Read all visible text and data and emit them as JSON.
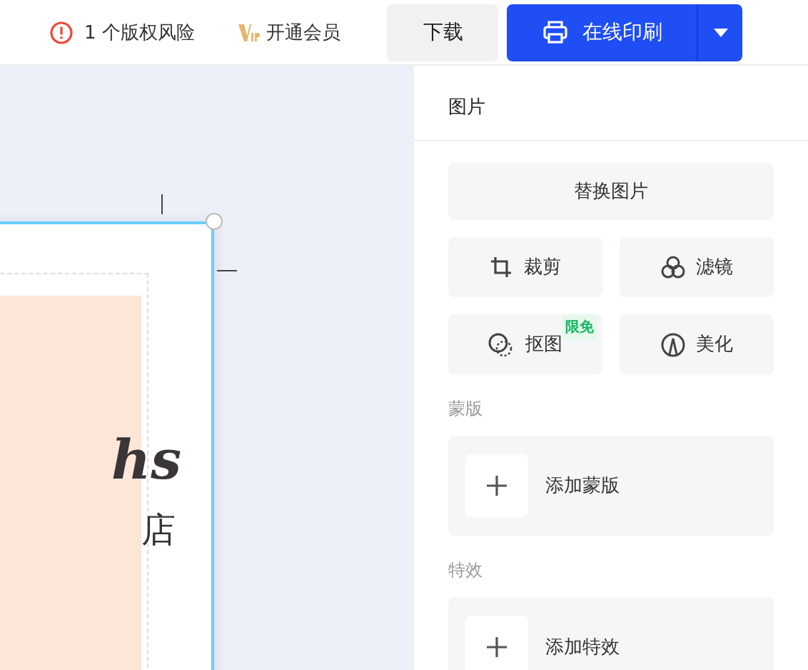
{
  "toolbar": {
    "copyright_risk": "1 个版权风险",
    "vip": "开通会员",
    "download": "下载",
    "print": "在线印刷"
  },
  "canvas": {
    "design_texts": [
      "hs",
      "店"
    ]
  },
  "panel": {
    "title": "图片",
    "replace": "替换图片",
    "tools": [
      {
        "kind": "crop",
        "label": "裁剪"
      },
      {
        "kind": "filter",
        "label": "滤镜"
      },
      {
        "kind": "cutout",
        "label": "抠图",
        "badge": "限免"
      },
      {
        "kind": "beautify",
        "label": "美化"
      }
    ],
    "sections": [
      {
        "title": "蒙版",
        "action": "添加蒙版"
      },
      {
        "title": "特效",
        "action": "添加特效"
      }
    ]
  }
}
